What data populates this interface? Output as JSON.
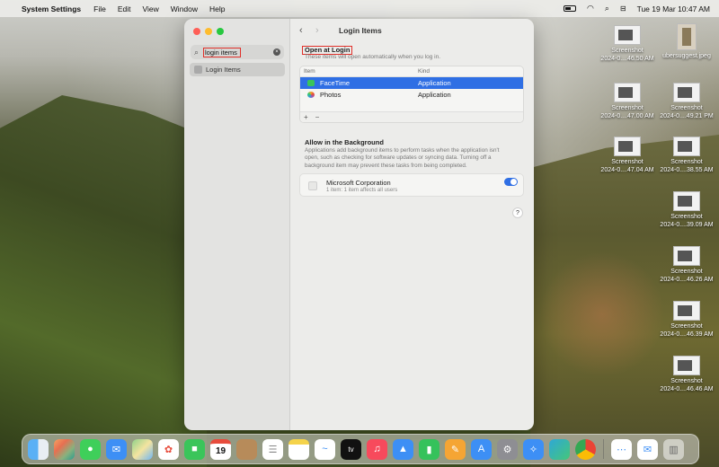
{
  "menubar": {
    "app_name": "System Settings",
    "menus": [
      "File",
      "Edit",
      "View",
      "Window",
      "Help"
    ],
    "datetime": "Tue 19 Mar  10:47 AM"
  },
  "window": {
    "sidebar": {
      "search_value": "login items",
      "result_label": "Login Items"
    },
    "toolbar": {
      "title": "Login Items"
    },
    "open_at_login": {
      "title": "Open at Login",
      "description": "These items will open automatically when you log in.",
      "columns": [
        "Item",
        "Kind"
      ],
      "rows": [
        {
          "name": "FaceTime",
          "kind": "Application",
          "selected": true
        },
        {
          "name": "Photos",
          "kind": "Application",
          "selected": false
        }
      ],
      "add_label": "+",
      "remove_label": "−"
    },
    "background": {
      "title": "Allow in the Background",
      "description": "Applications add background items to perform tasks when the application isn't open, such as checking for software updates or syncing data. Turning off a background item may prevent these tasks from being completed.",
      "item_name": "Microsoft Corporation",
      "item_sub": "1 item: 1 item affects all users",
      "toggle_on": true
    },
    "help_label": "?"
  },
  "desktop_icons": [
    {
      "label1": "Screenshot",
      "label2": "2024-0....46.50 AM"
    },
    {
      "label1": "ubersuggest.jpeg",
      "label2": ""
    },
    {
      "label1": "Screenshot",
      "label2": "2024-0....47.00 AM"
    },
    {
      "label1": "Screenshot",
      "label2": "2024-0....49.21 PM"
    },
    {
      "label1": "Screenshot",
      "label2": "2024-0....47.04 AM"
    },
    {
      "label1": "Screenshot",
      "label2": "2024-0....38.55 AM"
    },
    {
      "label1": "Screenshot",
      "label2": "2024-0....39.09 AM"
    },
    {
      "label1": "Screenshot",
      "label2": "2024-0....46.26 AM"
    },
    {
      "label1": "Screenshot",
      "label2": "2024-0....46.39 AM"
    },
    {
      "label1": "Screenshot",
      "label2": "2024-0....46.46 AM"
    }
  ],
  "dock": {
    "calendar_day": "19",
    "tv_label": "tv",
    "apps": [
      "finder",
      "launchpad",
      "messages",
      "mail",
      "maps",
      "photos",
      "facetime",
      "calendar",
      "contacts",
      "reminders",
      "notes",
      "freeform",
      "tv",
      "music",
      "keynote",
      "numbers",
      "pages",
      "app-store",
      "system-settings",
      "safari",
      "edge",
      "chrome",
      "feedback",
      "mail-alt",
      "trash"
    ]
  }
}
